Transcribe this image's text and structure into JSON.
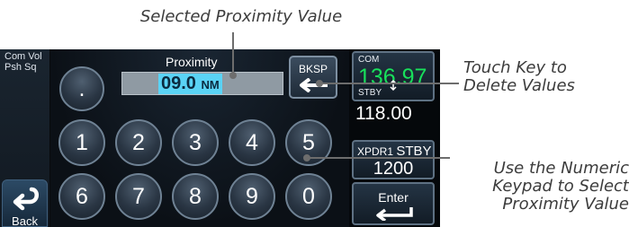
{
  "callouts": {
    "selected_value": "Selected Proximity Value",
    "bksp_note": "Touch Key to Delete Values",
    "keypad_note": "Use the Numeric Keypad to Select Proximity Value"
  },
  "left_rail": {
    "com_vol_line1": "Com Vol",
    "com_vol_line2": "Psh Sq",
    "back_label": "Back"
  },
  "keypad": {
    "title": "Proximity",
    "value": "09.0",
    "unit": "NM",
    "bksp_label": "BKSP",
    "decimal_key": ".",
    "row1": [
      "1",
      "2",
      "3",
      "4",
      "5"
    ],
    "row2": [
      "6",
      "7",
      "8",
      "9",
      "0"
    ]
  },
  "right_rail": {
    "com_label": "COM",
    "com_active": "136.97",
    "stby_label": "STBY",
    "com_standby": "118.00",
    "xpdr_label": "XPDR1",
    "xpdr_mode": "STBY",
    "xpdr_code": "1200",
    "enter_label": "Enter"
  },
  "colors": {
    "active_freq": "#18e05b",
    "value_highlight": "#5ad3f5",
    "screen_bg": "#080a0c",
    "key_border": "#6f8294"
  },
  "icons": {
    "back": "back-arrow-icon",
    "backspace": "left-arrow-icon",
    "swap": "swap-arrow-icon",
    "enter": "enter-arrow-icon"
  }
}
